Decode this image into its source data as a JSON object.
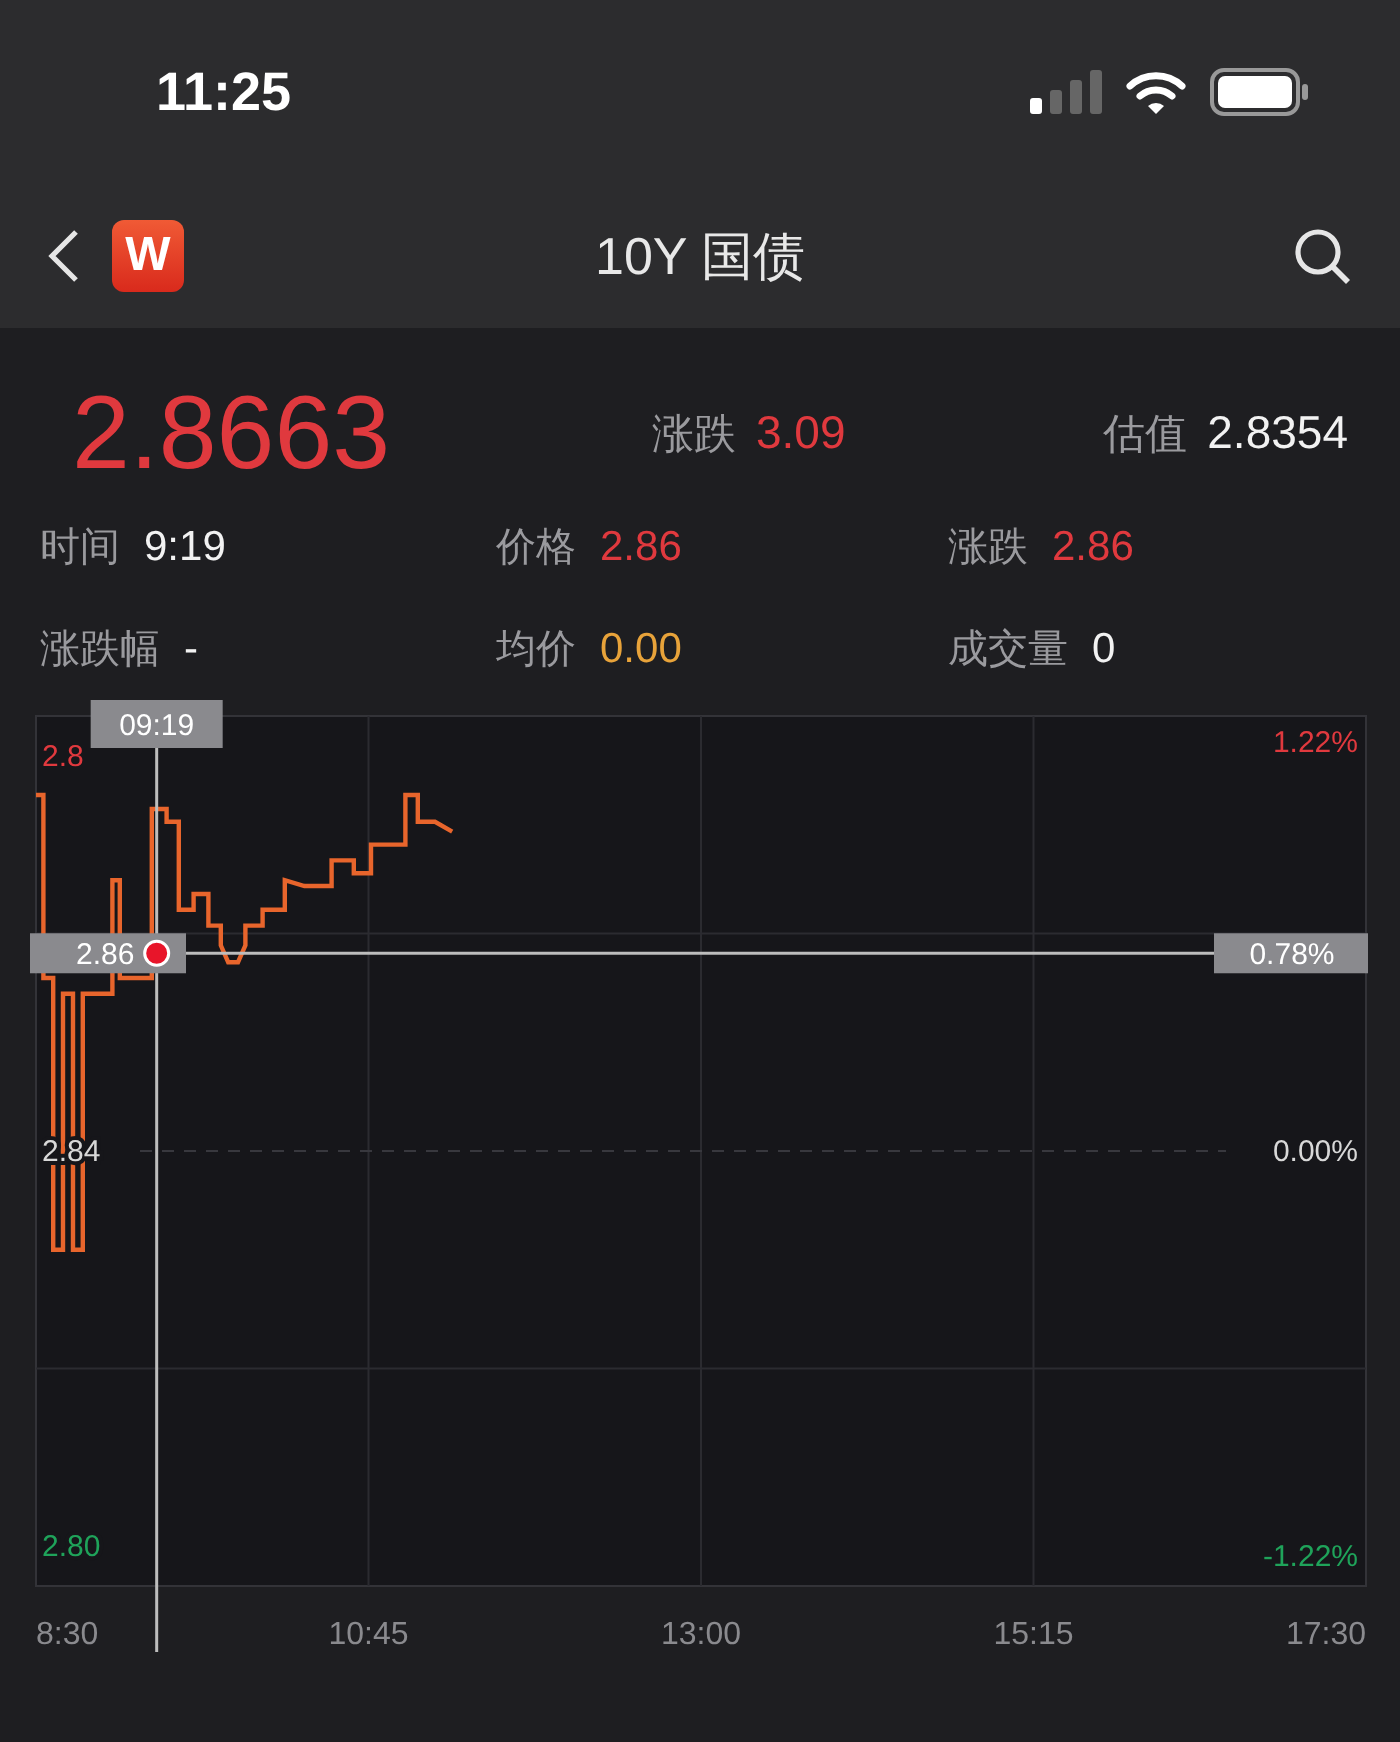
{
  "status_bar": {
    "time": "11:25"
  },
  "nav": {
    "logo_text": "W",
    "title": "10Y 国债"
  },
  "quote": {
    "price": "2.8663",
    "color": "#e0393e",
    "stats": [
      {
        "label": "涨跌",
        "value": "3.09",
        "color": "#e0393e"
      },
      {
        "label": "估值",
        "value": "2.8354",
        "color": "#f2f2f2"
      }
    ]
  },
  "details": [
    {
      "label": "时间",
      "value": "9:19",
      "color": "#f2f2f2"
    },
    {
      "label": "价格",
      "value": "2.86",
      "color": "#e0393e"
    },
    {
      "label": "涨跌",
      "value": "2.86",
      "color": "#e0393e"
    },
    {
      "label": "涨跌幅",
      "value": "-",
      "color": "#f2f2f2"
    },
    {
      "label": "均价",
      "value": "0.00",
      "color": "#e8a33a"
    },
    {
      "label": "成交量",
      "value": "0",
      "color": "#f2f2f2"
    }
  ],
  "chart": {
    "crosshair": {
      "time": "09:19",
      "change": "0.78%"
    },
    "top_axis_label": "2.8",
    "right_labels": [
      {
        "text": "1.22%",
        "color": "#e0393e"
      },
      {
        "text": "0.00%",
        "color": "#d8d8d8"
      },
      {
        "text": "-1.22%",
        "color": "#1fa35a"
      }
    ],
    "chart_data": {
      "type": "line",
      "xlim": [
        510,
        1050
      ],
      "ylim": [
        2.796,
        2.884
      ],
      "grid": true,
      "ref_lines": [
        {
          "axis": "y",
          "value": 2.84
        },
        {
          "axis": "x",
          "value": 559
        },
        {
          "axis": "y",
          "value": 2.86,
          "label": "2.86"
        }
      ],
      "xticks": [
        {
          "value": 510,
          "label": "8:30"
        },
        {
          "value": 645,
          "label": "10:45"
        },
        {
          "value": 780,
          "label": "13:00"
        },
        {
          "value": 915,
          "label": "15:15"
        },
        {
          "value": 1050,
          "label": "17:30"
        }
      ],
      "yticks": [
        {
          "value": 2.84,
          "label": "2.84"
        },
        {
          "value": 2.8,
          "label": "2.80"
        }
      ],
      "x": [
        510,
        513,
        513,
        517,
        517,
        521,
        521,
        525,
        525,
        529,
        529,
        541,
        541,
        544,
        544,
        557,
        557,
        563,
        563,
        568,
        568,
        574,
        574,
        580,
        580,
        585,
        585,
        588,
        592,
        595,
        595,
        602,
        602,
        611,
        611,
        619,
        630,
        630,
        639,
        639,
        646,
        646,
        660,
        660,
        665,
        665,
        672,
        679
      ],
      "series": [
        {
          "color": "#e8652c",
          "values": [
            2.876,
            2.876,
            2.8575,
            2.8575,
            2.83,
            2.83,
            2.8559,
            2.8559,
            2.83,
            2.83,
            2.8559,
            2.8559,
            2.8674,
            2.8674,
            2.8575,
            2.8575,
            2.8746,
            2.8746,
            2.8733,
            2.8733,
            2.8644,
            2.8644,
            2.866,
            2.866,
            2.8628,
            2.8628,
            2.8608,
            2.8591,
            2.8591,
            2.8608,
            2.8628,
            2.8628,
            2.8644,
            2.8644,
            2.8674,
            2.8668,
            2.8668,
            2.8694,
            2.8694,
            2.8681,
            2.8681,
            2.871,
            2.871,
            2.876,
            2.876,
            2.8733,
            2.8733,
            2.8723
          ]
        }
      ]
    }
  }
}
